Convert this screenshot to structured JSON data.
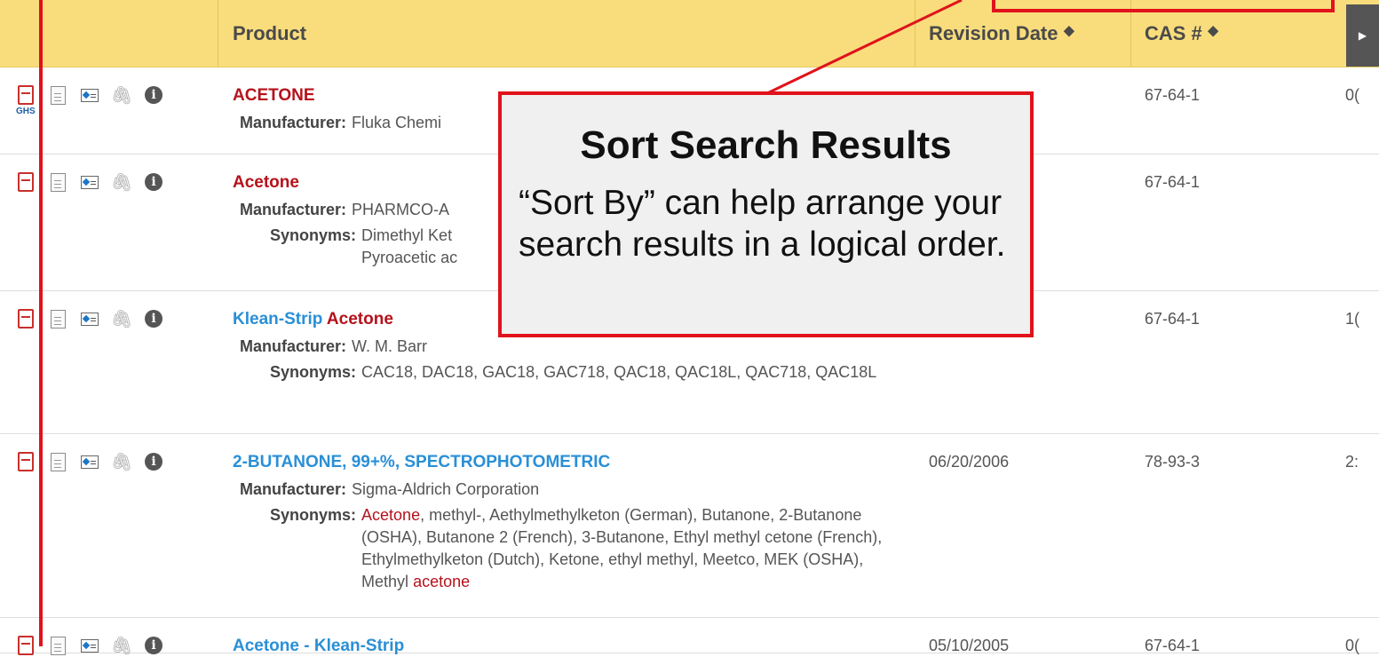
{
  "header": {
    "product": "Product",
    "revision_date": "Revision Date",
    "cas": "CAS #",
    "sort_glyph": "↕"
  },
  "rows": [
    {
      "title_parts": [
        {
          "text": "ACETONE",
          "color": "red"
        }
      ],
      "manufacturer_label": "Manufacturer:",
      "manufacturer": "Fluka Chemi",
      "synonyms_label": "",
      "synonyms_parts": [],
      "revision": "",
      "cas": "67-64-1",
      "extra": "0(",
      "ghs": "GHS"
    },
    {
      "title_parts": [
        {
          "text": "Acetone",
          "color": "red"
        }
      ],
      "manufacturer_label": "Manufacturer:",
      "manufacturer": "PHARMCO-A",
      "synonyms_label": "Synonyms:",
      "synonyms_parts": [
        {
          "text": "Dimethyl Ket",
          "color": ""
        }
      ],
      "synonyms_line2": "Pyroacetic ac",
      "revision": "",
      "cas": "67-64-1",
      "extra": ""
    },
    {
      "title_parts": [
        {
          "text": "Klean-Strip ",
          "color": "blue"
        },
        {
          "text": "Acetone",
          "color": "red"
        }
      ],
      "manufacturer_label": "Manufacturer:",
      "manufacturer": "W. M. Barr",
      "synonyms_label": "Synonyms:",
      "synonyms_parts": [
        {
          "text": "CAC18, DAC18, GAC18, GAC718, QAC18, QAC18L, QAC718, QAC18L",
          "color": ""
        }
      ],
      "revision": "",
      "cas": "67-64-1",
      "extra": "1("
    },
    {
      "title_parts": [
        {
          "text": "2-BUTANONE, 99+%, SPECTROPHOTOMETRIC",
          "color": "blue"
        }
      ],
      "manufacturer_label": "Manufacturer:",
      "manufacturer": "Sigma-Aldrich Corporation",
      "synonyms_label": "Synonyms:",
      "synonyms_parts": [
        {
          "text": "Acetone",
          "color": "red"
        },
        {
          "text": ", methyl-, Aethylmethylketon (German), Butanone, 2-Butanone (OSHA), Butanone 2 (French), 3-Butanone, Ethyl methyl cetone (French), Ethylmethylketon (Dutch), Ketone, ethyl methyl, Meetco, MEK (OSHA), Methyl ",
          "color": ""
        },
        {
          "text": "acetone",
          "color": "red"
        }
      ],
      "revision": "06/20/2006",
      "cas": "78-93-3",
      "extra": "2:"
    },
    {
      "title_parts": [
        {
          "text": "Acetone - Klean-Strip",
          "color": "blue"
        }
      ],
      "manufacturer_label": "",
      "manufacturer": "",
      "synonyms_label": "",
      "synonyms_parts": [],
      "revision": "05/10/2005",
      "cas": "67-64-1",
      "extra": "0("
    }
  ],
  "callout": {
    "title": "Sort  Search Results",
    "body": "“Sort By” can help arrange your search results in a logical order."
  },
  "colors": {
    "header_bg": "#f9dd7c",
    "accent_red": "#e0121b",
    "link_red": "#b5121b",
    "link_blue": "#2a8fd6"
  },
  "icons": [
    "pdf-icon",
    "document-icon",
    "label-icon",
    "paperclip-icon",
    "info-icon"
  ]
}
